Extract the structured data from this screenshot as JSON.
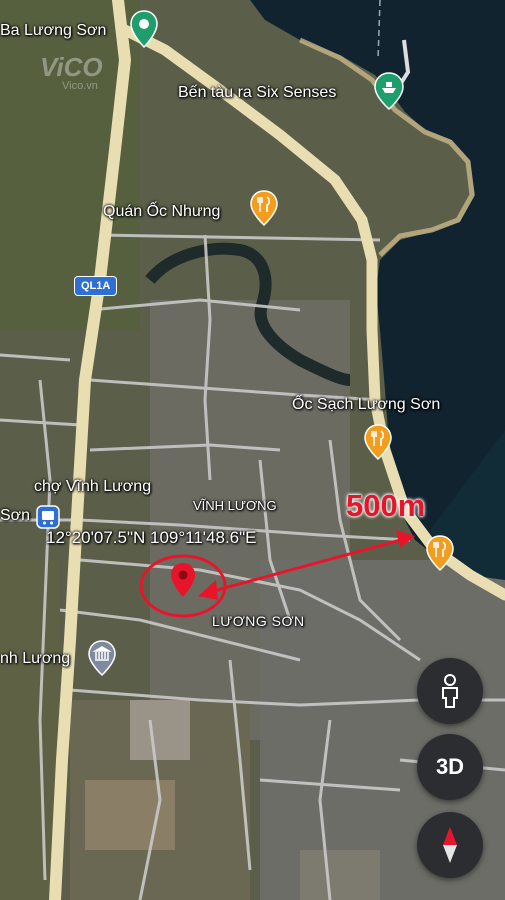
{
  "watermark": {
    "brand": "ViCO",
    "site": "Vico.vn"
  },
  "labels": {
    "ba_luong_son": "Ba Lương Sơn",
    "ferry": "Bến tàu ra Six Senses",
    "quan_oc_nhung": "Quán Ốc Nhưng",
    "oc_sach": "Ốc Sạch Lương Sơn",
    "cho_vinh_luong": "chợ Vĩnh Lương",
    "son_station": "Sơn",
    "vinh_luong_area": "VĨNH LƯƠNG",
    "luong_son_area": "LƯƠNG SƠN",
    "nh_luong": "nh Lương",
    "highway": "QL1A"
  },
  "annotation": {
    "coordinates": "12°20'07.5\"N 109°11'48.6\"E",
    "distance": "500m",
    "color": "#e8152a"
  },
  "controls": {
    "street_view_icon": "person-icon",
    "three_d_label": "3D",
    "compass_icon": "compass-icon"
  },
  "colors": {
    "road_major": "#e8dcb0",
    "road_minor": "#c9c9c9",
    "sea": "#10232f",
    "land": "#5a5d48",
    "poi_orange": "#f29d1e",
    "poi_green": "#1e9e6a",
    "control_bg": "#2b2d30"
  }
}
